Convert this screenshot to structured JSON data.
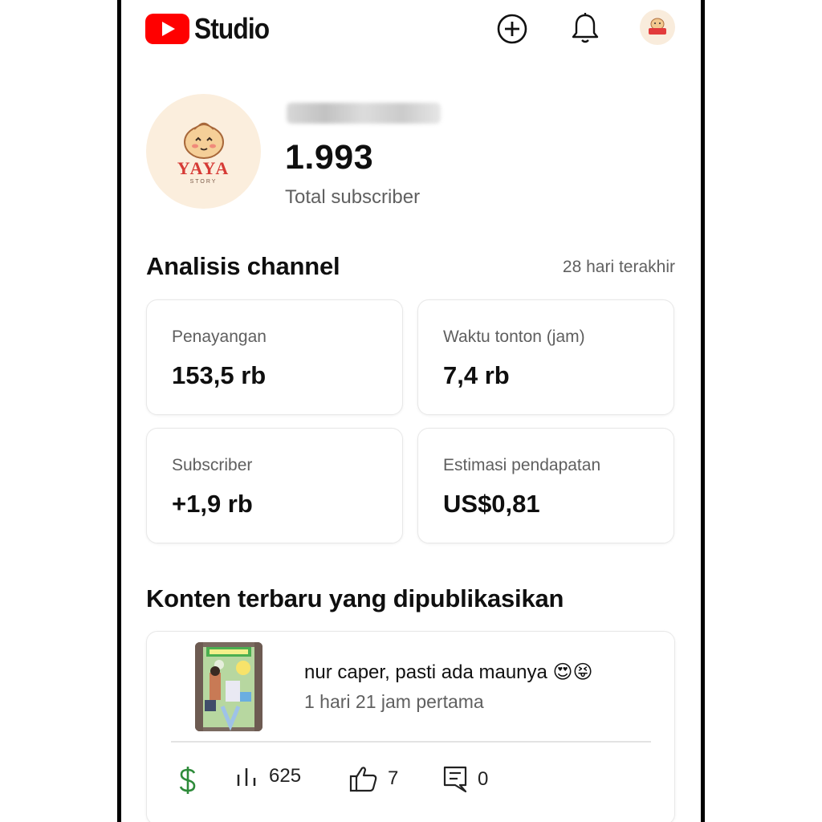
{
  "header": {
    "logo_text": "Studio",
    "icons": [
      "youtube-logo-icon",
      "add-circle-icon",
      "bell-icon",
      "avatar-icon"
    ],
    "brand_color": "#ff0000"
  },
  "channel": {
    "subscriber_count": "1.993",
    "subscriber_label": "Total subscriber",
    "avatar_text": "YAYA",
    "avatar_subtext": "STORY"
  },
  "analytics": {
    "title": "Analisis channel",
    "period": "28 hari terakhir",
    "cards": [
      {
        "label": "Penayangan",
        "value": "153,5 rb"
      },
      {
        "label": "Waktu tonton (jam)",
        "value": "7,4 rb"
      },
      {
        "label": "Subscriber",
        "value": "+1,9 rb"
      },
      {
        "label": "Estimasi pendapatan",
        "value": "US$0,81"
      }
    ]
  },
  "recent": {
    "title": "Konten terbaru yang dipublikasikan",
    "video": {
      "title": "nur caper, pasti ada maunya 😍😝",
      "time": "1 hari 21 jam pertama",
      "views": "625",
      "likes": "7",
      "comments": "0"
    },
    "stat_icons": [
      "dollar-icon",
      "bar-chart-icon",
      "thumbs-up-icon",
      "comment-icon"
    ],
    "monetization_color": "#2e8b3a"
  }
}
